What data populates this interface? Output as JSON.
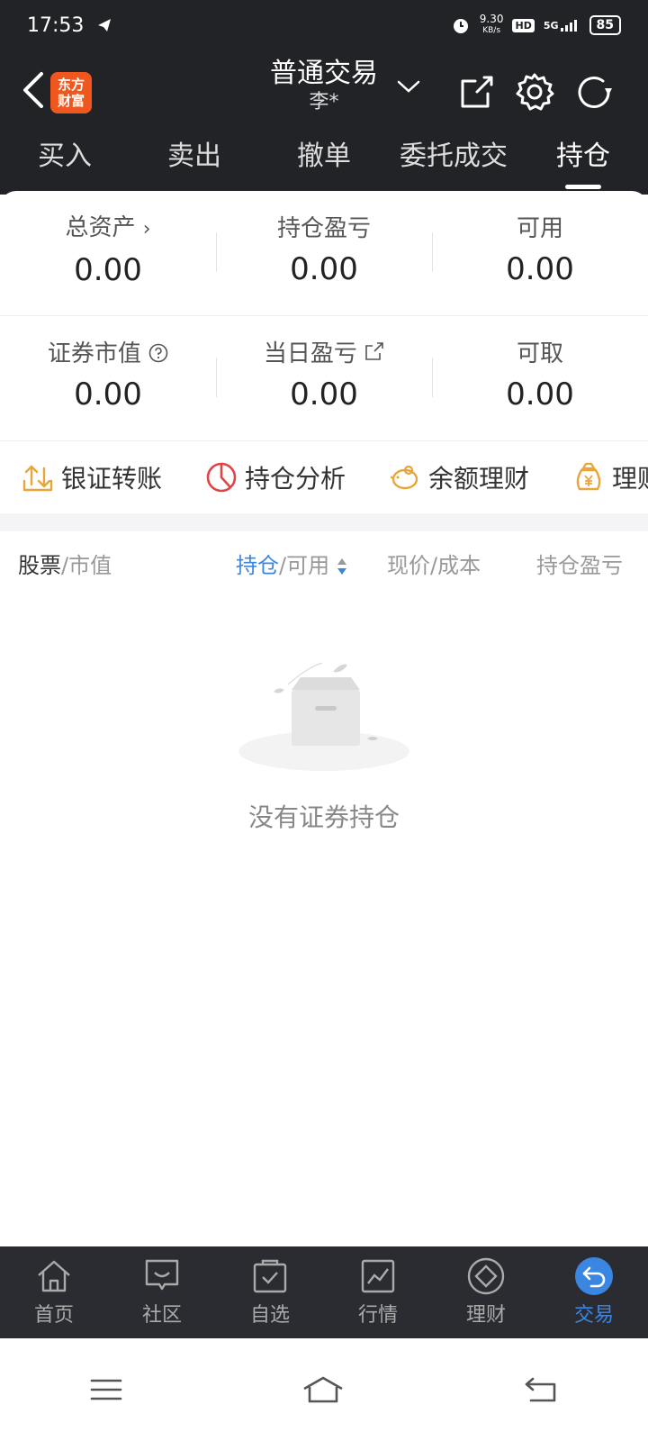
{
  "status_bar": {
    "time": "17:53",
    "net_speed_value": "9.30",
    "net_speed_unit": "KB/s",
    "hd": "HD",
    "network": "5G",
    "battery": "85"
  },
  "header": {
    "logo_line1": "东方",
    "logo_line2": "财富",
    "title": "普通交易",
    "subtitle": "李*"
  },
  "tabs": [
    {
      "label": "买入"
    },
    {
      "label": "卖出"
    },
    {
      "label": "撤单"
    },
    {
      "label": "委托成交"
    },
    {
      "label": "持仓",
      "active": true
    }
  ],
  "stats": {
    "total_assets_label": "总资产",
    "total_assets_value": "0.00",
    "position_pnl_label": "持仓盈亏",
    "position_pnl_value": "0.00",
    "available_label": "可用",
    "available_value": "0.00",
    "market_value_label": "证券市值",
    "market_value_value": "0.00",
    "daily_pnl_label": "当日盈亏",
    "daily_pnl_value": "0.00",
    "withdrawable_label": "可取",
    "withdrawable_value": "0.00"
  },
  "quick_actions": [
    {
      "label": "银证转账",
      "icon": "transfer-icon"
    },
    {
      "label": "持仓分析",
      "icon": "pie-chart-icon"
    },
    {
      "label": "余额理财",
      "icon": "piggy-bank-icon"
    },
    {
      "label": "理财",
      "icon": "money-bag-icon"
    }
  ],
  "columns": {
    "stock": "股票",
    "market_value": "/市值",
    "holding": "持仓",
    "available": "/可用",
    "price_cost": "现价/成本",
    "pnl": "持仓盈亏"
  },
  "empty_text": "没有证券持仓",
  "bottom_nav": [
    {
      "label": "首页",
      "icon": "home-icon"
    },
    {
      "label": "社区",
      "icon": "community-icon"
    },
    {
      "label": "自选",
      "icon": "watchlist-icon"
    },
    {
      "label": "行情",
      "icon": "market-icon"
    },
    {
      "label": "理财",
      "icon": "wealth-icon"
    },
    {
      "label": "交易",
      "icon": "trade-icon",
      "active": true
    }
  ],
  "colors": {
    "accent_blue": "#3b86e0",
    "brand_orange": "#f0571e",
    "dark_bg": "#222327",
    "gold": "#e8a53a"
  }
}
